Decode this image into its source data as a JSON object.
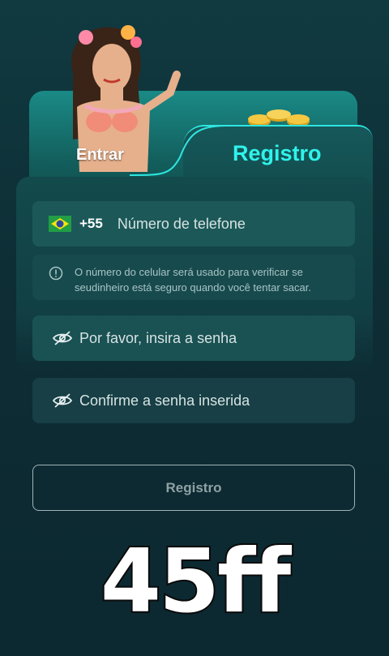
{
  "tabs": {
    "login_label": "Entrar",
    "register_label": "Registro"
  },
  "phone": {
    "country_flag": "brazil-flag-icon",
    "ddi": "+55",
    "placeholder": "Número de telefone"
  },
  "notice": {
    "icon": "info-icon",
    "text": "O número do celular será usado para verificar se seudinheiro está seguro quando você tentar sacar."
  },
  "password": {
    "icon": "eye-off-icon",
    "placeholder": "Por favor, insira a senha"
  },
  "confirm_password": {
    "icon": "eye-off-icon",
    "placeholder": "Confirme a senha inserida"
  },
  "submit_label": "Registro",
  "brand_text": "45ff",
  "colors": {
    "accent": "#2ff3ea",
    "background": "#0e2d35",
    "field": "#1b5557"
  }
}
